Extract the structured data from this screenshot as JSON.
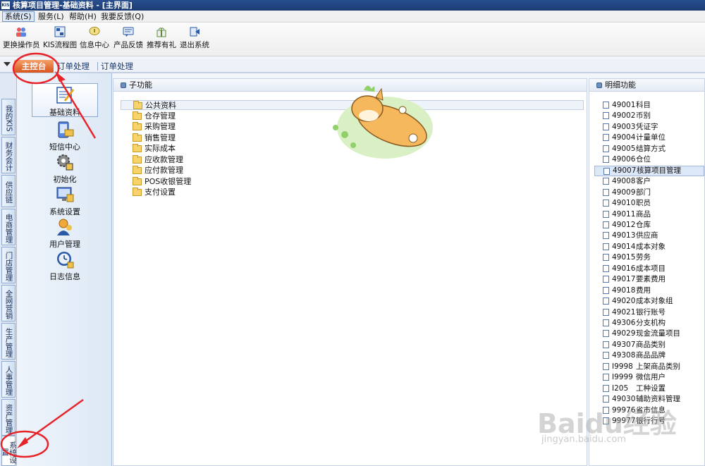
{
  "window": {
    "logo_text": "KIS",
    "title": "核算项目管理-基础资料 - [主界面]"
  },
  "menubar": {
    "items": [
      "系统(S)",
      "服务(L)",
      "帮助(H)",
      "我要反馈(Q)"
    ]
  },
  "toolbar": {
    "items": [
      "更换操作员",
      "KIS流程图",
      "信息中心",
      "产品反馈",
      "推荐有礼",
      "退出系统"
    ]
  },
  "tabs": {
    "main": "主控台",
    "items": [
      "订单处理",
      "订单处理"
    ]
  },
  "vertical_tabs": [
    "我的KIS",
    "财务会计",
    "供应链",
    "电商管理",
    "门店管理",
    "全网营销",
    "生产管理",
    "人事管理",
    "资产管理",
    "系统设置"
  ],
  "nav": {
    "items": [
      "基础资料",
      "短信中心",
      "初始化",
      "系统设置",
      "用户管理",
      "日志信息"
    ]
  },
  "sub_panel": {
    "title": "子功能",
    "parent": "公共资料",
    "folders": [
      "仓存管理",
      "采购管理",
      "销售管理",
      "实际成本",
      "应收款管理",
      "应付款管理",
      "POS收银管理",
      "支付设置"
    ]
  },
  "detail_panel": {
    "title": "明细功能",
    "rows": [
      {
        "code": "49001",
        "name": "科目"
      },
      {
        "code": "49002",
        "name": "币别"
      },
      {
        "code": "49003",
        "name": "凭证字"
      },
      {
        "code": "49004",
        "name": "计量单位"
      },
      {
        "code": "49005",
        "name": "结算方式"
      },
      {
        "code": "49006",
        "name": "仓位"
      },
      {
        "code": "49007",
        "name": "核算项目管理"
      },
      {
        "code": "49008",
        "name": "客户"
      },
      {
        "code": "49009",
        "name": "部门"
      },
      {
        "code": "49010",
        "name": "职员"
      },
      {
        "code": "49011",
        "name": "商品"
      },
      {
        "code": "49012",
        "name": "仓库"
      },
      {
        "code": "49013",
        "name": "供应商"
      },
      {
        "code": "49014",
        "name": "成本对象"
      },
      {
        "code": "49015",
        "name": "劳务"
      },
      {
        "code": "49016",
        "name": "成本项目"
      },
      {
        "code": "49017",
        "name": "要素费用"
      },
      {
        "code": "49018",
        "name": "费用"
      },
      {
        "code": "49020",
        "name": "成本对象组"
      },
      {
        "code": "49021",
        "name": "银行账号"
      },
      {
        "code": "49306",
        "name": "分支机构"
      },
      {
        "code": "49029",
        "name": "现金流量项目"
      },
      {
        "code": "49307",
        "name": "商品类别"
      },
      {
        "code": "49308",
        "name": "商品品牌"
      },
      {
        "code": "I9998",
        "name": "上架商品类别"
      },
      {
        "code": "I9999",
        "name": "微信用户"
      },
      {
        "code": "I205",
        "name": "工种设置"
      },
      {
        "code": "49030",
        "name": "辅助资料管理"
      },
      {
        "code": "99976",
        "name": "省市信息"
      },
      {
        "code": "99977",
        "name": "银行行号"
      }
    ]
  },
  "watermark": {
    "line1": "Baidu经验",
    "line2": "jingyan.baidu.com"
  },
  "colors": {
    "annotation_red": "#e8242a",
    "main_tab_orange": "#d7551d",
    "selection_blue": "#dce7f7"
  }
}
